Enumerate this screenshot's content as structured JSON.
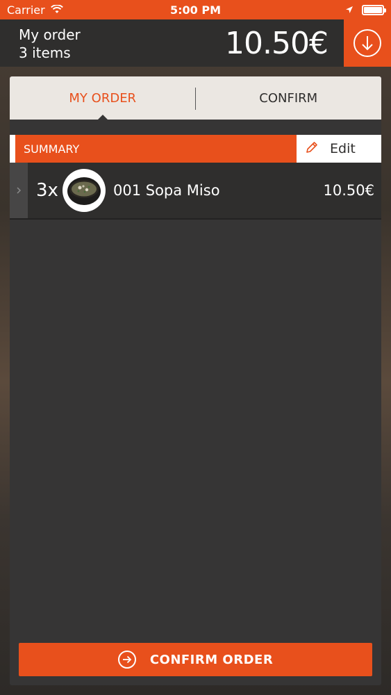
{
  "status_bar": {
    "carrier": "Carrier",
    "time": "5:00 PM"
  },
  "header": {
    "title": "My order",
    "item_count": "3 items",
    "total": "10.50€",
    "action_icon": "arrow-down-circle-icon"
  },
  "tabs": [
    {
      "label": "MY ORDER",
      "active": true
    },
    {
      "label": "CONFIRM",
      "active": false
    }
  ],
  "summary": {
    "label": "SUMMARY",
    "edit_label": "Edit"
  },
  "order_items": [
    {
      "quantity": "3x",
      "name": "001 Sopa Miso",
      "price": "10.50€",
      "thumbnail": "miso-soup-bowl"
    }
  ],
  "confirm_button": {
    "label": "CONFIRM ORDER"
  },
  "colors": {
    "accent": "#e8501c",
    "dark": "#2f2e2d",
    "panel": "#363535",
    "tab_bg": "#ebe7e2"
  }
}
